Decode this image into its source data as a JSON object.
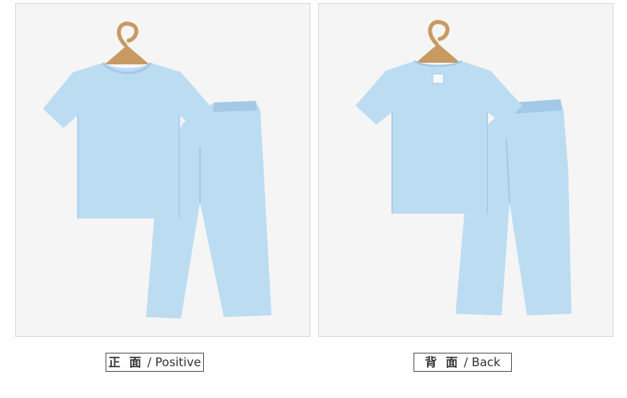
{
  "panels": [
    {
      "view": "front",
      "caption_cn": "正 面",
      "caption_sep": " / ",
      "caption_en": "Positive"
    },
    {
      "view": "back",
      "caption_cn": "背 面",
      "caption_sep": " / ",
      "caption_en": "Back"
    }
  ],
  "colors": {
    "garment": "#bcdcf2",
    "garment_shade": "#a3c9e6",
    "hanger": "#c79a62",
    "panel_bg": "#f5f5f5",
    "border": "#d8d8d8"
  }
}
